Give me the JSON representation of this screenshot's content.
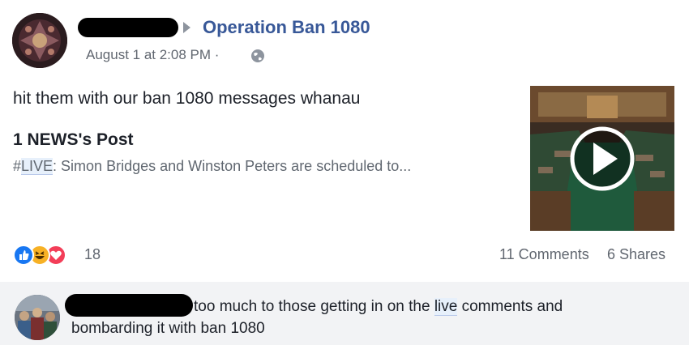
{
  "post": {
    "group_name": "Operation Ban 1080",
    "timestamp": "August 1 at 2:08 PM ·",
    "privacy_icon": "globe-icon",
    "text": "hit them with our ban 1080 messages whanau"
  },
  "shared": {
    "title": "1 NEWS's Post",
    "snippet_hashtag": "#",
    "snippet_tag": "LIVE",
    "snippet_rest": ": Simon Bridges and Winston Peters are scheduled to...",
    "thumbnail_icon": "play-icon"
  },
  "reactions": {
    "icons": [
      "like-icon",
      "haha-icon",
      "love-icon"
    ],
    "count": "18",
    "comments": "11 Comments",
    "shares": "6 Shares"
  },
  "comment": {
    "text_pre": "too much to those getting in on the ",
    "text_highlight": "live",
    "text_post": " comments and",
    "line2": "bombarding it with ban 1080"
  },
  "colors": {
    "link": "#385898",
    "like": "#1877f2",
    "haha": "#f7b125",
    "love": "#f33e58",
    "comment_bg": "#f2f3f5"
  }
}
